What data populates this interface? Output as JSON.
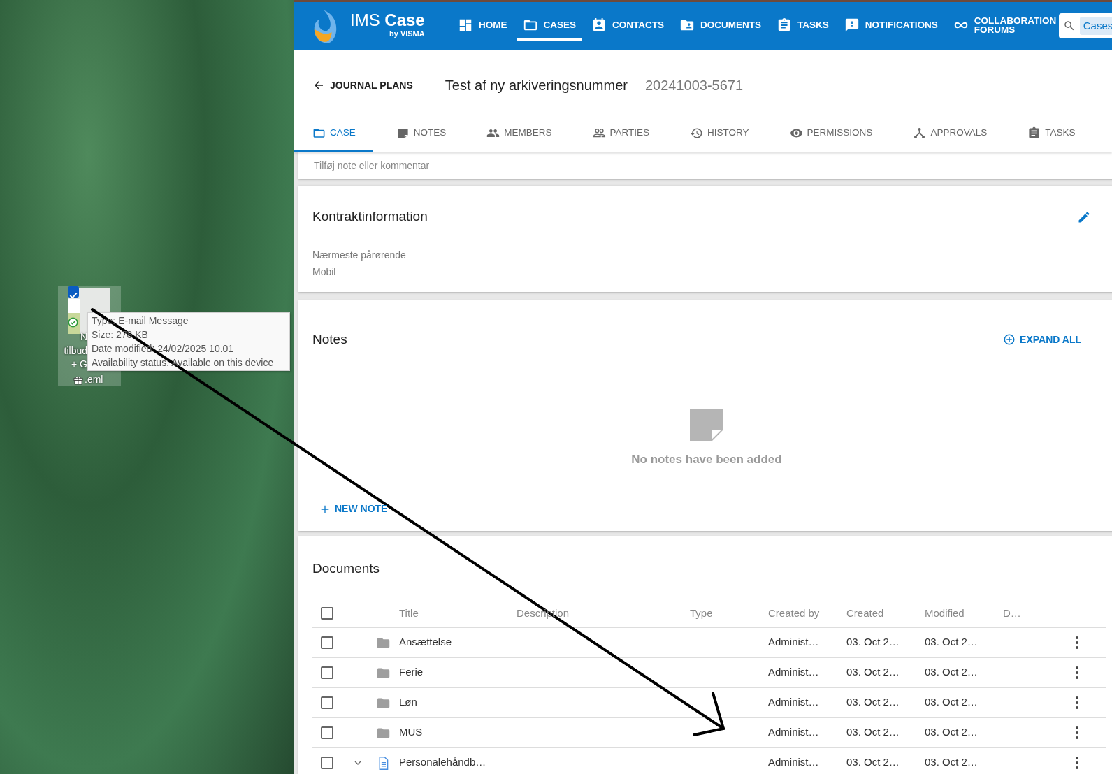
{
  "desktop": {
    "file_icon": {
      "selected": true,
      "checked": true,
      "label_lines": [
        "N",
        "tilbud",
        "+ G"
      ],
      "label_ext": ".eml"
    },
    "tooltip": {
      "lines": [
        "Type: E-mail Message",
        "Size: 278 KB",
        "Date modified: 24/02/2025 10.01",
        "Availability status: Available on this device"
      ]
    }
  },
  "app": {
    "logo": "IMS **Case**",
    "logo_sub": "by VISMA",
    "nav": [
      {
        "label": "HOME",
        "selected": false
      },
      {
        "label": "CASES",
        "selected": true
      },
      {
        "label": "CONTACTS",
        "selected": false
      },
      {
        "label": "DOCUMENTS",
        "selected": false
      },
      {
        "label": "TASKS",
        "selected": false
      },
      {
        "label": "NOTIFICATIONS",
        "selected": false
      },
      {
        "label": "COLLABORATION FORUMS",
        "selected": false
      }
    ],
    "search": {
      "scope": "Cases"
    }
  },
  "case_header": {
    "back": "JOURNAL PLANS",
    "title": "Test af ny arkiveringsnummer",
    "number": "20241003-5671"
  },
  "tabs": [
    {
      "label": "CASE",
      "selected": true
    },
    {
      "label": "NOTES",
      "selected": false
    },
    {
      "label": "MEMBERS",
      "selected": false
    },
    {
      "label": "PARTIES",
      "selected": false
    },
    {
      "label": "HISTORY",
      "selected": false
    },
    {
      "label": "PERMISSIONS",
      "selected": false
    },
    {
      "label": "APPROVALS",
      "selected": false
    },
    {
      "label": "TASKS",
      "selected": false
    }
  ],
  "note_input": {
    "placeholder": "Tilføj note eller kommentar"
  },
  "contract": {
    "title": "Kontraktinformation",
    "fields": [
      "Nærmeste pårørende",
      "Mobil"
    ]
  },
  "notes": {
    "title": "Notes",
    "expand_all": "EXPAND ALL",
    "empty": "No notes have been added",
    "new_note": "NEW NOTE"
  },
  "documents": {
    "title": "Documents",
    "all_checked": false,
    "columns": [
      "Title",
      "Description",
      "Type",
      "Created by",
      "Created",
      "Modified",
      "D…"
    ],
    "rows": [
      {
        "kind": "folder",
        "checked": false,
        "title": "Ansættelse",
        "created_by": "Administ…",
        "created": "03. Oct 2…",
        "modified": "03. Oct 2…"
      },
      {
        "kind": "folder",
        "checked": false,
        "title": "Ferie",
        "created_by": "Administ…",
        "created": "03. Oct 2…",
        "modified": "03. Oct 2…"
      },
      {
        "kind": "folder",
        "checked": false,
        "title": "Løn",
        "created_by": "Administ…",
        "created": "03. Oct 2…",
        "modified": "03. Oct 2…"
      },
      {
        "kind": "folder",
        "checked": false,
        "title": "MUS",
        "created_by": "Administ…",
        "created": "03. Oct 2…",
        "modified": "03. Oct 2…"
      },
      {
        "kind": "document",
        "checked": false,
        "title": "Personalehåndb…",
        "created_by": "Administ…",
        "created": "03. Oct 2…",
        "modified": "03. Oct 2…"
      }
    ]
  }
}
